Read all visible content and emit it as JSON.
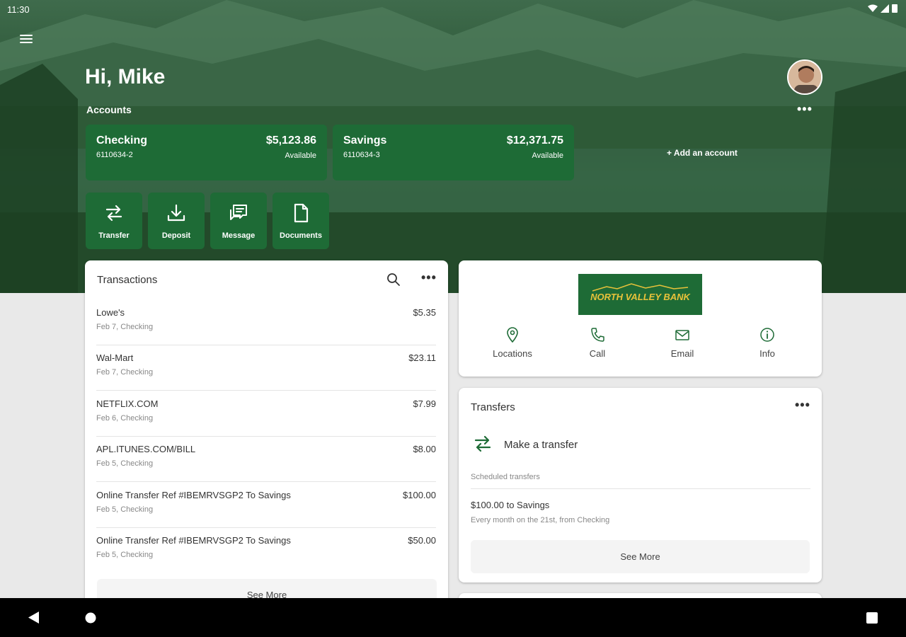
{
  "status": {
    "time": "11:30"
  },
  "header": {
    "greeting": "Hi, Mike",
    "accounts_label": "Accounts",
    "more": "•••",
    "add_account": "+ Add an account"
  },
  "accounts": [
    {
      "name": "Checking",
      "number": "6110634-2",
      "balance": "$5,123.86",
      "status": "Available"
    },
    {
      "name": "Savings",
      "number": "6110634-3",
      "balance": "$12,371.75",
      "status": "Available"
    }
  ],
  "actions": [
    {
      "label": "Transfer",
      "icon": "transfer-icon"
    },
    {
      "label": "Deposit",
      "icon": "deposit-icon"
    },
    {
      "label": "Message",
      "icon": "message-icon"
    },
    {
      "label": "Documents",
      "icon": "document-icon"
    }
  ],
  "transactions": {
    "title": "Transactions",
    "more": "•••",
    "see_more": "See More",
    "items": [
      {
        "description": "Lowe's",
        "meta": "Feb 7, Checking",
        "amount": "$5.35"
      },
      {
        "description": "Wal-Mart",
        "meta": "Feb 7, Checking",
        "amount": "$23.11"
      },
      {
        "description": "NETFLIX.COM",
        "meta": "Feb 6, Checking",
        "amount": "$7.99"
      },
      {
        "description": "APL.ITUNES.COM/BILL",
        "meta": "Feb 5, Checking",
        "amount": "$8.00"
      },
      {
        "description": "Online Transfer Ref #IBEMRVSGP2 To Savings",
        "meta": "Feb 5, Checking",
        "amount": "$100.00"
      },
      {
        "description": "Online Transfer Ref #IBEMRVSGP2 To Savings",
        "meta": "Feb 5, Checking",
        "amount": "$50.00"
      }
    ]
  },
  "bank": {
    "logo_text": "NORTH VALLEY BANK",
    "links": [
      {
        "label": "Locations",
        "icon": "location-pin-icon"
      },
      {
        "label": "Call",
        "icon": "phone-icon"
      },
      {
        "label": "Email",
        "icon": "email-icon"
      },
      {
        "label": "Info",
        "icon": "info-icon"
      }
    ]
  },
  "transfers": {
    "title": "Transfers",
    "more": "•••",
    "make_transfer": "Make a transfer",
    "scheduled_label": "Scheduled transfers",
    "scheduled": [
      {
        "title": "$100.00 to Savings",
        "detail": "Every month on the 21st, from Checking"
      }
    ],
    "see_more": "See More"
  },
  "colors": {
    "brand_green": "#1e6b36",
    "logo_gold": "#e8c23a"
  }
}
